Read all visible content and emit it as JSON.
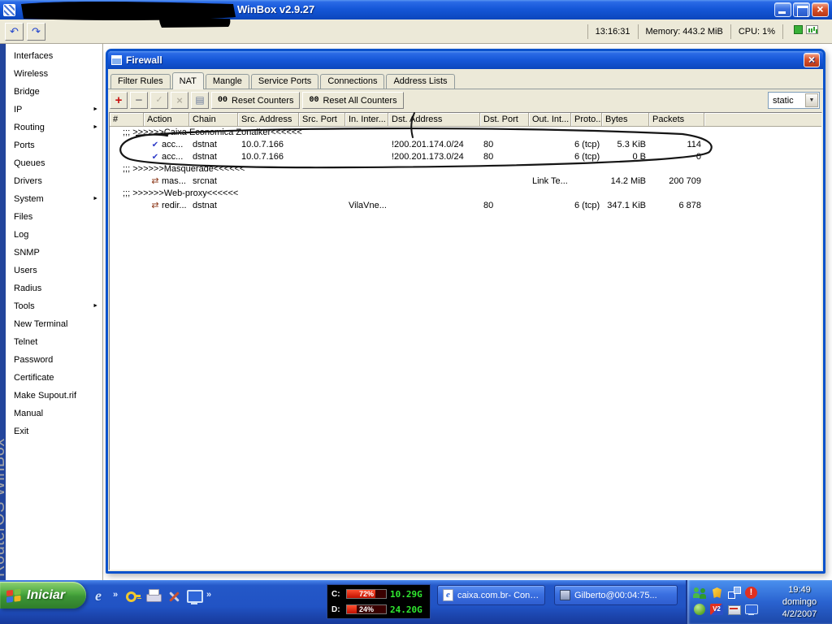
{
  "app": {
    "title": "WinBox v2.9.27",
    "toolbar": {
      "status": {
        "time": "13:16:31",
        "memory_label": "Memory:",
        "memory_value": "443.2 MiB",
        "cpu_label": "CPU:",
        "cpu_value": "1%"
      }
    }
  },
  "sidebar": {
    "brand": "RouterOS WinBox",
    "items": [
      {
        "label": "Interfaces",
        "has_submenu": false
      },
      {
        "label": "Wireless",
        "has_submenu": false
      },
      {
        "label": "Bridge",
        "has_submenu": false
      },
      {
        "label": "IP",
        "has_submenu": true
      },
      {
        "label": "Routing",
        "has_submenu": true
      },
      {
        "label": "Ports",
        "has_submenu": false
      },
      {
        "label": "Queues",
        "has_submenu": false
      },
      {
        "label": "Drivers",
        "has_submenu": false
      },
      {
        "label": "System",
        "has_submenu": true
      },
      {
        "label": "Files",
        "has_submenu": false
      },
      {
        "label": "Log",
        "has_submenu": false
      },
      {
        "label": "SNMP",
        "has_submenu": false
      },
      {
        "label": "Users",
        "has_submenu": false
      },
      {
        "label": "Radius",
        "has_submenu": false
      },
      {
        "label": "Tools",
        "has_submenu": true
      },
      {
        "label": "New Terminal",
        "has_submenu": false
      },
      {
        "label": "Telnet",
        "has_submenu": false
      },
      {
        "label": "Password",
        "has_submenu": false
      },
      {
        "label": "Certificate",
        "has_submenu": false
      },
      {
        "label": "Make Supout.rif",
        "has_submenu": false
      },
      {
        "label": "Manual",
        "has_submenu": false
      },
      {
        "label": "Exit",
        "has_submenu": false
      }
    ]
  },
  "firewall": {
    "title": "Firewall",
    "tabs": [
      "Filter Rules",
      "NAT",
      "Mangle",
      "Service Ports",
      "Connections",
      "Address Lists"
    ],
    "active_tab": "NAT",
    "toolbar": {
      "action_buttons": [
        "add-icon",
        "remove-icon",
        "enable-icon",
        "disable-icon",
        "comment-icon"
      ],
      "reset_counters_prefix": "00",
      "reset_counters_label": "Reset Counters",
      "reset_all_prefix": "00",
      "reset_all_label": "Reset All Counters",
      "filter_value": "static"
    },
    "columns": [
      "#",
      "Action",
      "Chain",
      "Src. Address",
      "Src. Port",
      "In. Inter...",
      "Dst. Address",
      "Dst. Port",
      "Out. Int...",
      "Proto...",
      "Bytes",
      "Packets"
    ],
    "rows": [
      {
        "type": "comment",
        "text": ";;; >>>>>>Caixa Economica Zonaiker<<<<<<"
      },
      {
        "type": "rule",
        "icon": "accept-icon",
        "action": "acc...",
        "chain": "dstnat",
        "src_address": "10.0.7.166",
        "src_port": "",
        "in_interface": "",
        "dst_address": "!200.201.174.0/24",
        "dst_port": "80",
        "out_interface": "",
        "proto": "6 (tcp)",
        "bytes": "5.3 KiB",
        "packets": "114"
      },
      {
        "type": "rule",
        "icon": "accept-icon",
        "action": "acc...",
        "chain": "dstnat",
        "src_address": "10.0.7.166",
        "src_port": "",
        "in_interface": "",
        "dst_address": "!200.201.173.0/24",
        "dst_port": "80",
        "out_interface": "",
        "proto": "6 (tcp)",
        "bytes": "0 B",
        "packets": "0"
      },
      {
        "type": "comment",
        "text": ";;; >>>>>>Masquerade<<<<<<"
      },
      {
        "type": "rule",
        "icon": "nat-icon",
        "action": "mas...",
        "chain": "srcnat",
        "src_address": "",
        "src_port": "",
        "in_interface": "",
        "dst_address": "",
        "dst_port": "",
        "out_interface": "Link Te...",
        "proto": "",
        "bytes": "14.2 MiB",
        "packets": "200 709"
      },
      {
        "type": "comment",
        "text": ";;; >>>>>>Web-proxy<<<<<<"
      },
      {
        "type": "rule",
        "icon": "nat-icon",
        "action": "redir...",
        "chain": "dstnat",
        "src_address": "",
        "src_port": "",
        "in_interface": "VilaVne...",
        "dst_address": "",
        "dst_port": "80",
        "out_interface": "",
        "proto": "6 (tcp)",
        "bytes": "347.1 KiB",
        "packets": "6 878"
      }
    ]
  },
  "taskbar": {
    "start": {
      "label": "Iniciar"
    },
    "quick_launch": [
      "ie-icon",
      "chevron-icon",
      "key-icon",
      "printer-icon",
      "tools-icon",
      "monitor-icon",
      "chevron-icon"
    ],
    "performance": {
      "drives": [
        {
          "label": "C:",
          "percent": "72%",
          "fill": 72,
          "value": "10.29G"
        },
        {
          "label": "D:",
          "percent": "24%",
          "fill": 24,
          "value": "24.20G"
        }
      ]
    },
    "buttons": [
      {
        "icon": "ie-page-icon",
        "label": "caixa.com.br- Cone..."
      },
      {
        "icon": "session-icon",
        "label": "Gilberto@00:04:75..."
      }
    ],
    "tray": {
      "icons": [
        "users-icon",
        "shield-icon",
        "network-icon",
        "alert-icon",
        "update-icon",
        "v2-icon",
        "scanner-icon",
        "monitor-icon"
      ],
      "clock": {
        "time": "19:49",
        "day": "domingo",
        "date": "4/2/2007"
      }
    }
  }
}
